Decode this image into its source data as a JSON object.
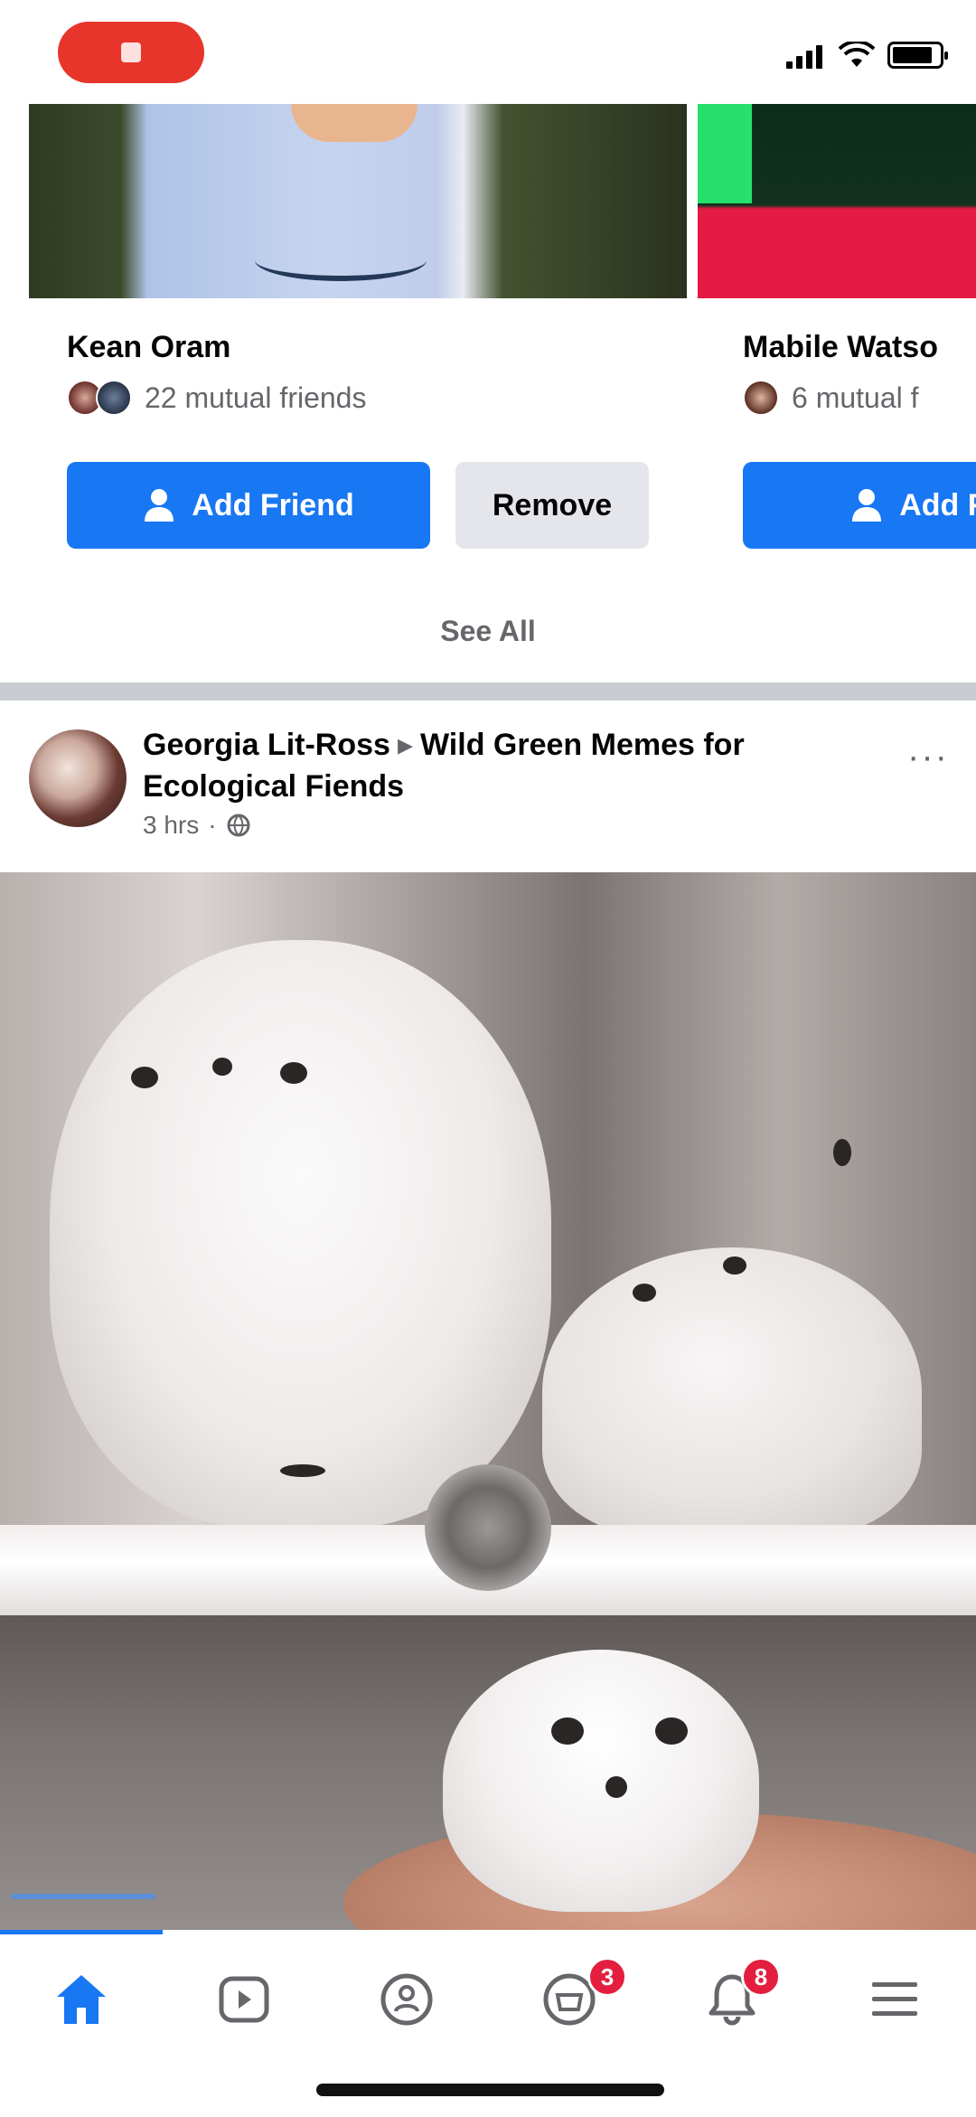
{
  "status_bar": {
    "recording_label": "",
    "icons": [
      "signal-icon",
      "wifi-icon",
      "battery-icon"
    ]
  },
  "people_you_may_know": {
    "cards": [
      {
        "name": "Kean Oram",
        "mutual_friends": "22 mutual friends",
        "add_label": "Add Friend",
        "remove_label": "Remove"
      },
      {
        "name": "Mabile Watso",
        "mutual_friends": "6 mutual f",
        "add_label": "Add Fr"
      }
    ],
    "see_all_label": "See All"
  },
  "post": {
    "author": "Georgia Lit-Ross",
    "group": "Wild Green Memes for Ecological Fiends",
    "time": "3 hrs",
    "more_label": "···",
    "image_alt": "Snowy owl figurines on a shelf"
  },
  "tab_bar": {
    "tabs": [
      {
        "name": "home",
        "icon": "home-icon",
        "active": true
      },
      {
        "name": "watch",
        "icon": "watch-icon",
        "active": false
      },
      {
        "name": "groups",
        "icon": "groups-icon",
        "active": false
      },
      {
        "name": "marketplace",
        "icon": "marketplace-icon",
        "active": false,
        "badge": "3"
      },
      {
        "name": "notifications",
        "icon": "bell-icon",
        "active": false,
        "badge": "8"
      },
      {
        "name": "menu",
        "icon": "menu-icon",
        "active": false
      }
    ]
  },
  "colors": {
    "accent": "#1877f2",
    "badge": "#e41e3f",
    "recording": "#e8352b",
    "secondary_text": "#65676b"
  }
}
